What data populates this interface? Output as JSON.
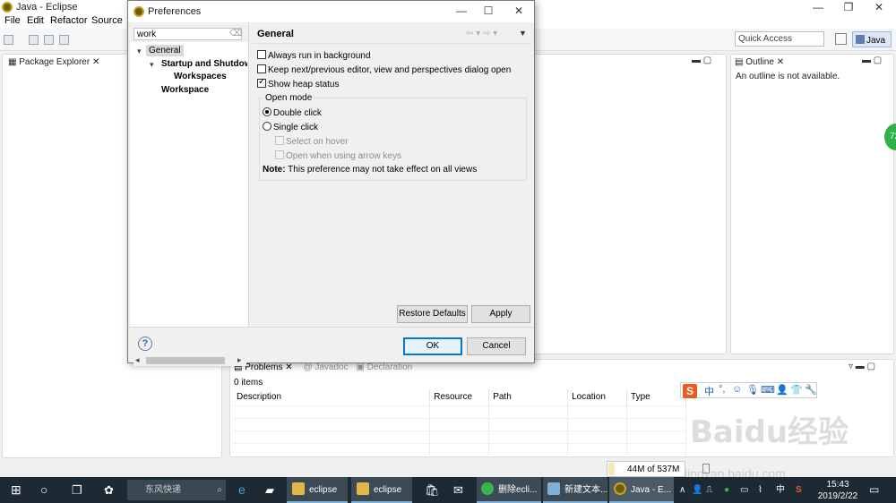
{
  "eclipse": {
    "title": "Java - Eclipse",
    "menus": [
      "File",
      "Edit",
      "Refactor",
      "Source"
    ],
    "quick_access": "Quick Access",
    "perspective": "Java",
    "package_explorer_tab": "Package Explorer",
    "outline_tab": "Outline",
    "outline_message": "An outline is not available.",
    "problems_tabs": [
      "Problems",
      "Javadoc",
      "Declaration"
    ],
    "items_count": "0 items",
    "problems_columns": [
      "Description",
      "Resource",
      "Path",
      "Location",
      "Type"
    ],
    "memory": "44M of 537M",
    "memory_fraction": 0.08,
    "side_badge": "72"
  },
  "dialog": {
    "title": "Preferences",
    "filter_value": "work",
    "tree": [
      "General",
      "Startup and Shutdown",
      "Workspaces",
      "Workspace"
    ],
    "page_title": "General",
    "options": {
      "always_background": "Always run in background",
      "keep_next_prev": "Keep next/previous editor, view and perspectives dialog open",
      "show_heap": "Show heap status"
    },
    "open_mode": {
      "label": "Open mode",
      "double_click": "Double click",
      "single_click": "Single click",
      "select_hover": "Select on hover",
      "open_arrow": "Open when using arrow keys",
      "note_label": "Note:",
      "note_text": "This preference may not take effect on all views"
    },
    "restore_defaults": "Restore Defaults",
    "apply": "Apply",
    "ok": "OK",
    "cancel": "Cancel"
  },
  "taskbar": {
    "search_text": "东风快递",
    "apps": [
      "eclipse",
      "eclipse",
      "删除ecli...",
      "新建文本...",
      "Java - E..."
    ],
    "ime_lang": "中",
    "time": "15:43",
    "date": "2019/2/22"
  },
  "watermark": {
    "text": "Baidu经验",
    "sub": "jingyan.baidu.com"
  }
}
